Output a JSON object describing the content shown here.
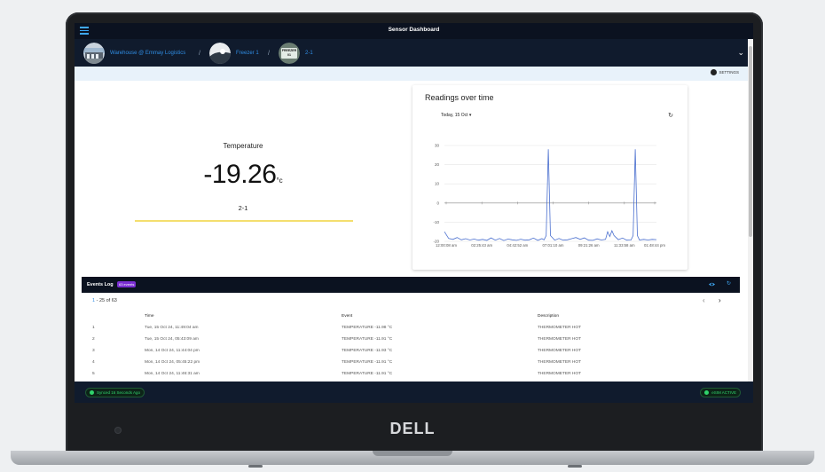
{
  "app": {
    "title": "Sensor Dashboard"
  },
  "breadcrumb": {
    "items": [
      {
        "label": "Warehouse @ Emmay Logistics"
      },
      {
        "label": "Freezer 1"
      },
      {
        "label": "2-1"
      }
    ],
    "separator": "/",
    "avatar_text": "FREEZER 01"
  },
  "toolbar": {
    "settings_label": "SETTINGS"
  },
  "temperature": {
    "label": "Temperature",
    "value": "-19.26",
    "unit": "°c",
    "sensor": "2-1"
  },
  "readings": {
    "title": "Readings over time",
    "date": "Today, 15 Oct",
    "date_caret": "▾",
    "refresh_icon": "↻"
  },
  "chart_data": {
    "type": "line",
    "title": "",
    "xlabel": "",
    "ylabel": "",
    "ylim": [
      -20,
      30
    ],
    "yticks": [
      30,
      20,
      10,
      0,
      -10,
      -20
    ],
    "xtick_labels": [
      "12:00:08 am",
      "02:25:43 am",
      "04:42:52 am",
      "07:01:10 am",
      "09:21:26 am",
      "11:33:58 am",
      "01:48:44 pm"
    ],
    "x": [
      0,
      2,
      4,
      6,
      8,
      10,
      12,
      14,
      16,
      18,
      20,
      22,
      24,
      26,
      28,
      30,
      32,
      34,
      36,
      38,
      40,
      42,
      44,
      46,
      47,
      48,
      49,
      50,
      52,
      54,
      56,
      58,
      60,
      62,
      64,
      66,
      68,
      70,
      72,
      74,
      76,
      77,
      78,
      79,
      80,
      82,
      84,
      86,
      88,
      89,
      90,
      91,
      92,
      94,
      96,
      98,
      100
    ],
    "series": [
      {
        "values": [
          -15,
          -18.5,
          -19,
          -18,
          -19.2,
          -18.6,
          -19.3,
          -18.8,
          -19.4,
          -19,
          -19.5,
          -18.2,
          -19.4,
          -18.5,
          -19.6,
          -18.8,
          -19.2,
          -19.5,
          -18.9,
          -19.4,
          -19.2,
          -18.3,
          -19.5,
          -18.6,
          -19.2,
          -17,
          28,
          -17,
          -19.4,
          -18.5,
          -19.4,
          -19.2,
          -18.6,
          -18,
          -19,
          -18.2,
          -19.4,
          -19.5,
          -18.7,
          -19.3,
          -19,
          -15,
          -17.5,
          -14.5,
          -17,
          -19.1,
          -18.3,
          -19.4,
          -19.3,
          -17,
          28,
          -17,
          -19.3,
          -19,
          -19.3,
          -19,
          -19.1
        ]
      }
    ],
    "grid": true,
    "color": "#4a6fcf"
  },
  "events": {
    "title": "Events Log",
    "badge": "63 events",
    "eye_icon": "eye-icon",
    "refresh_icon": "↻",
    "pager_range": "1",
    "pager_rest": " - 25 of 63",
    "prev": "‹",
    "next": "›",
    "columns": {
      "time": "Time",
      "event": "Event",
      "description": "Description"
    },
    "rows": [
      {
        "n": "1",
        "time": "Tue, 15 Oct 24, 11:49:04 am",
        "event": "TEMPERATURE -11.98 °C",
        "desc": "THERMOMETER HOT"
      },
      {
        "n": "2",
        "time": "Tue, 15 Oct 24, 05:43:09 am",
        "event": "TEMPERATURE -11.91 °C",
        "desc": "THERMOMETER HOT"
      },
      {
        "n": "3",
        "time": "Mon, 14 Oct 24, 11:44:04 pm",
        "event": "TEMPERATURE -11.93 °C",
        "desc": "THERMOMETER HOT"
      },
      {
        "n": "4",
        "time": "Mon, 14 Oct 24, 05:45:22 pm",
        "event": "TEMPERATURE -11.91 °C",
        "desc": "THERMOMETER HOT"
      },
      {
        "n": "5",
        "time": "Mon, 14 Oct 24, 11:46:31 am",
        "event": "TEMPERATURE -11.91 °C",
        "desc": "THERMOMETER HOT"
      }
    ]
  },
  "footer": {
    "sync_status": "Synced 16 Seconds Ago",
    "esim_status": "eSIM ACTIVE"
  },
  "device": {
    "brand": "DELL"
  },
  "colors": {
    "accent": "#2f8de4",
    "nav_bg": "#101b2d",
    "topbar_bg": "#0b1220",
    "status_green": "#2fd36b",
    "badge_purple": "#7a2ed1",
    "gauge_yellow": "#f4de6e"
  }
}
